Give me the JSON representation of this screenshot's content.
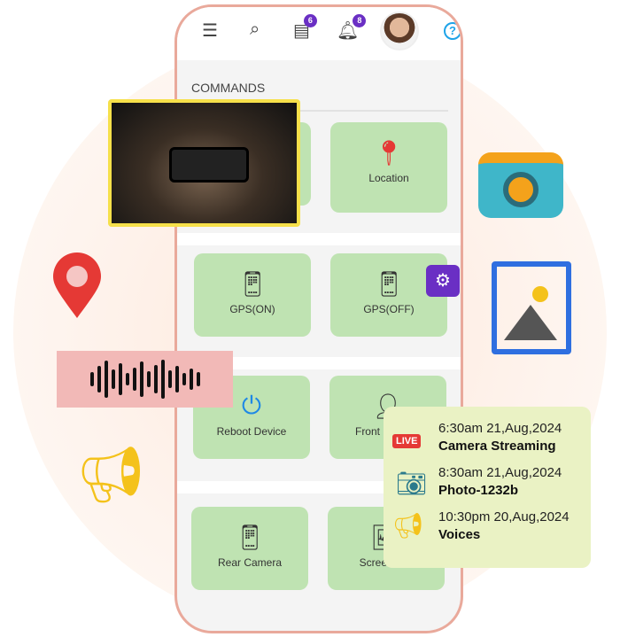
{
  "header": {
    "menu_icon": "hamburger-icon",
    "search_icon": "search-icon",
    "messages_badge": "6",
    "notifications_badge": "8",
    "help_icon": "help-icon"
  },
  "section_title": "COMMANDS",
  "tiles": [
    {
      "label": "Location",
      "icon": "map-pin-icon"
    },
    {
      "label": "GPS(ON)",
      "icon": "gps-on-icon"
    },
    {
      "label": "GPS(OFF)",
      "icon": "gps-off-icon"
    },
    {
      "label": "Reboot Device",
      "icon": "reboot-icon"
    },
    {
      "label": "Front Camera",
      "icon": "front-camera-icon"
    },
    {
      "label": "Rear Camera",
      "icon": "rear-camera-icon"
    },
    {
      "label": "Screenshot",
      "icon": "screenshot-icon"
    }
  ],
  "activity": [
    {
      "time": "6:30am 21,Aug,2024",
      "title": "Camera Streaming",
      "badge": "LIVE"
    },
    {
      "time": "8:30am 21,Aug,2024",
      "title": "Photo-1232b"
    },
    {
      "time": "10:30pm 20,Aug,2024",
      "title": "Voices"
    }
  ],
  "colors": {
    "tile": "#bfe3b2",
    "accent": "#6a2fc4",
    "phone_border": "#e9a99b",
    "card": "#eaf2c4"
  }
}
